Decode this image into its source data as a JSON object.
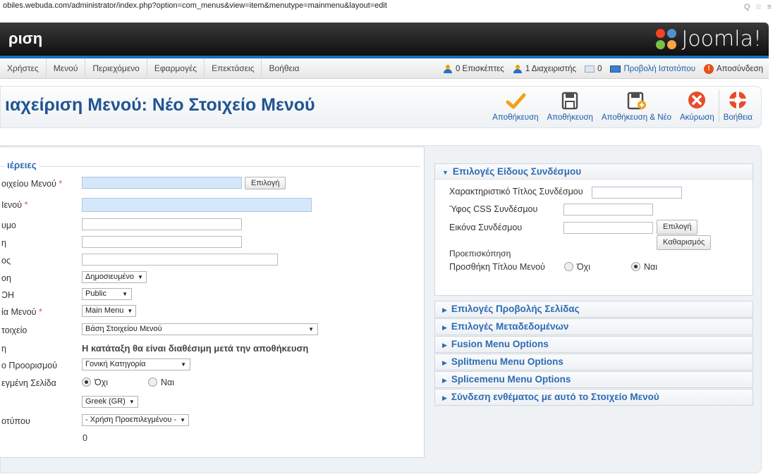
{
  "browser": {
    "url": "obiles.webuda.com/administrator/index.php?option=com_menus&view=item&menutype=mainmenu&layout=edit",
    "icons": "Q ☆ ≡"
  },
  "header": {
    "site_title": "ριση",
    "logo_text": "Joomla!"
  },
  "menubar": {
    "items": [
      "Χρήστες",
      "Μενού",
      "Περιεχόμενο",
      "Εφαρμογές",
      "Επεκτάσεις",
      "Βοήθεια"
    ],
    "visitors": "0 Επισκέπτες",
    "admins": "1 Διαχειριστής",
    "messages": "0",
    "view_site": "Προβολή Ιστοτόπου",
    "logout": "Αποσύνδεση"
  },
  "page": {
    "title": "ιαχείριση Μενού: Νέο Στοιχείο Μενού"
  },
  "toolbar": {
    "save_close": "Αποθήκευση",
    "save": "Αποθήκευση",
    "save_new": "Αποθήκευση & Νέο",
    "cancel": "Ακύρωση",
    "help": "Βοήθεια"
  },
  "details": {
    "legend": "ιέρειες",
    "fields": {
      "item_type": {
        "label": "οιχείου Μενού",
        "button": "Επιλογή"
      },
      "menu_title": {
        "label": "Ιενού"
      },
      "alias": {
        "label": "υμο"
      },
      "note": {
        "label": "η"
      },
      "link": {
        "label": "ος"
      },
      "status": {
        "label": "οη",
        "value": "Δημοσιευμένο"
      },
      "access": {
        "label": "ϽΗ",
        "value": "Public"
      },
      "menu_location": {
        "label": "ία Μενού",
        "value": "Main Menu"
      },
      "parent": {
        "label": "τοιχείο",
        "value": "Βάση Στοιχείου Μενού"
      },
      "ordering": {
        "label": "η",
        "note": "Η κατάταξη θα είναι διαθέσιμη μετά την αποθήκευση"
      },
      "target": {
        "label": "ο Προορισμού",
        "value": "Γονική Κατηγορία"
      },
      "default_page": {
        "label": "εγμένη Σελίδα",
        "no": "Όχι",
        "yes": "Ναι"
      },
      "language": {
        "value": "Greek (GR)"
      },
      "template": {
        "label": "οτύπου",
        "value": "- Χρήση Προεπιλεγμένου -"
      },
      "id": {
        "value": "0"
      }
    }
  },
  "link_options": {
    "header": "Επιλογές Είδους Συνδέσμου",
    "title_attr": "Χαρακτηριστικό Τίτλος Συνδέσμου",
    "css_style": "Ύφος CSS Συνδέσμου",
    "image": "Εικόνα Συνδέσμου",
    "select_btn": "Επιλογή",
    "clear_btn": "Καθαρισμός",
    "preview": "Προεπισκόπηση",
    "add_title": "Προσθήκη Τίτλου Μενού",
    "no": "Όχι",
    "yes": "Ναι"
  },
  "collapsed_panels": [
    "Επιλογές Προβολής Σελίδας",
    "Επιλογές Μεταδεδομένων",
    "Fusion Menu Options",
    "Splitmenu Menu Options",
    "Splicemenu Menu Options",
    "Σύνδεση ενθέματος με αυτό το Στοιχείο Μενού"
  ],
  "colors": {
    "accent": "#1d6fbb",
    "title": "#205493",
    "required": "#e05a36"
  }
}
